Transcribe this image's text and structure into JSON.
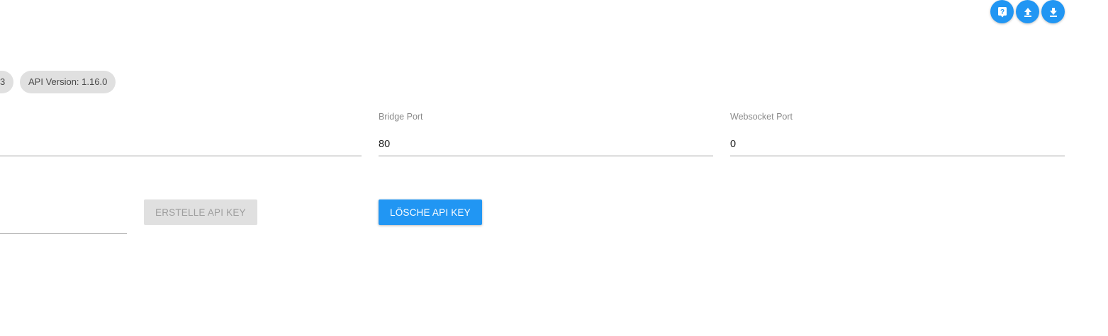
{
  "toolbar": {
    "buttons": [
      {
        "name": "help",
        "icon": "help-icon"
      },
      {
        "name": "upload",
        "icon": "upload-icon"
      },
      {
        "name": "download",
        "icon": "download-icon"
      }
    ],
    "accent_color": "#2196f3"
  },
  "chips": {
    "partial_label": "3",
    "api_version_label": "API Version: 1.16.0"
  },
  "fields": {
    "unlabeled_field": {
      "value": ""
    },
    "bridge_port": {
      "label": "Bridge Port",
      "value": "80"
    },
    "websocket_port": {
      "label": "Websocket Port",
      "value": "0"
    },
    "api_key_field": {
      "value": ""
    }
  },
  "actions": {
    "create_api_key_label": "ERSTELLE API KEY",
    "delete_api_key_label": "LÖSCHE API KEY"
  }
}
